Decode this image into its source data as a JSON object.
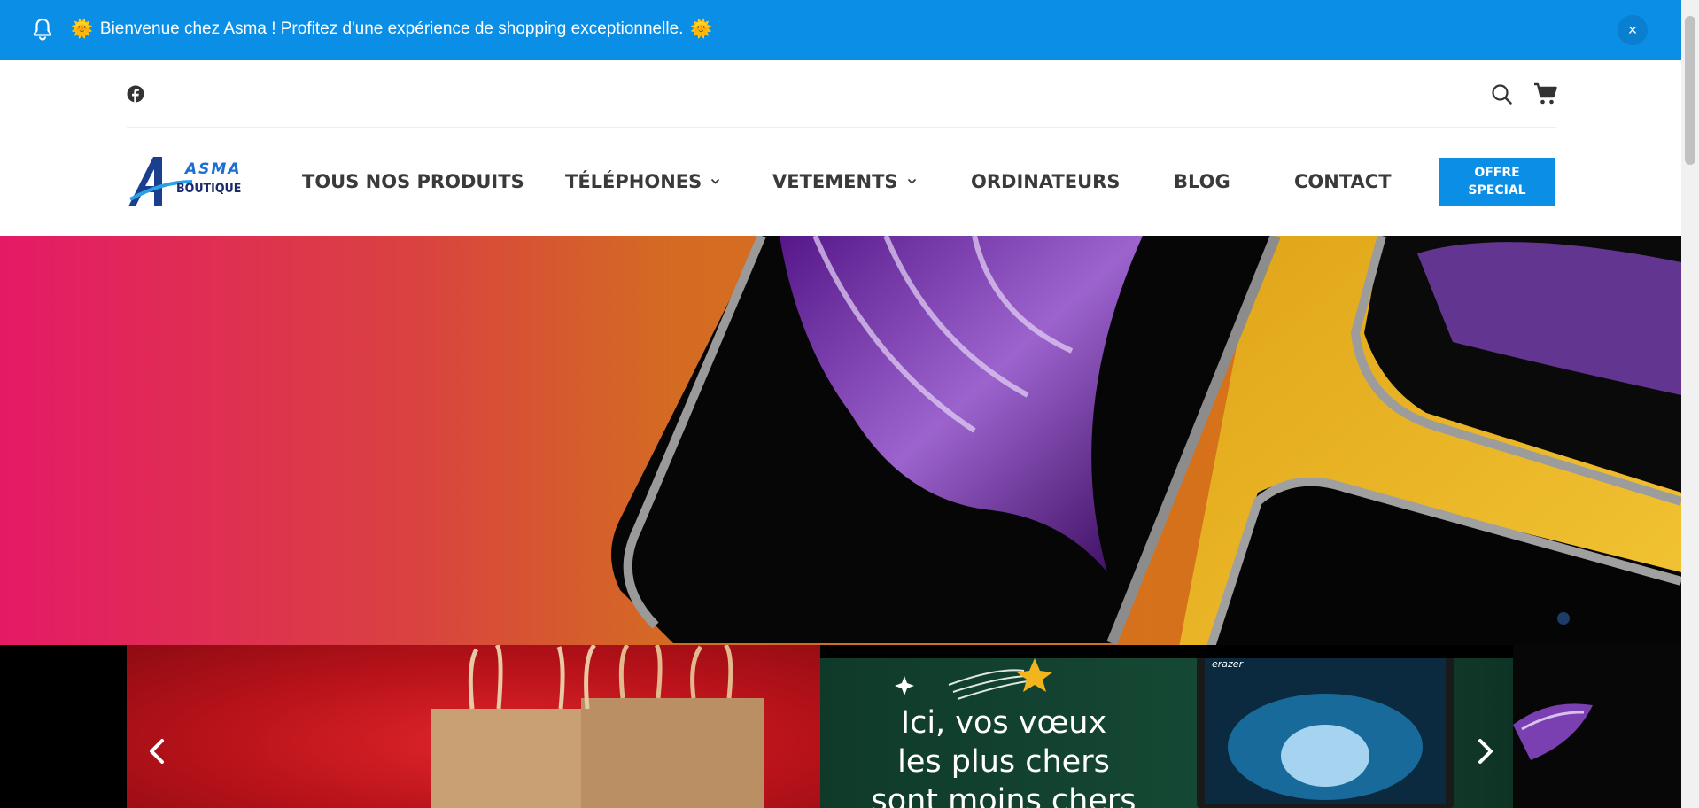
{
  "announcement": {
    "text": "Bienvenue chez Asma ! Profitez d'une expérience de shopping exceptionnelle.",
    "emoji_left": "🌞",
    "emoji_right": "🌞",
    "close_label": "×",
    "icon": "bell-icon",
    "background": "#0a8ee6"
  },
  "utility": {
    "social_icon": "facebook-icon",
    "search_icon": "search-icon",
    "cart_icon": "cart-icon"
  },
  "logo": {
    "mark": "A",
    "line1": "ASMA",
    "line2": "BOUTIQUE"
  },
  "nav": {
    "items": [
      {
        "label": "TOUS NOS PRODUITS",
        "has_dropdown": false
      },
      {
        "label": "TÉLÉPHONES",
        "has_dropdown": true
      },
      {
        "label": "VETEMENTS",
        "has_dropdown": true
      },
      {
        "label": "ORDINATEURS",
        "has_dropdown": false
      },
      {
        "label": "BLOG",
        "has_dropdown": false
      },
      {
        "label": "CONTACT",
        "has_dropdown": false
      }
    ],
    "offer_button": {
      "line1": "OFFRE",
      "line2": "SPECIAL"
    }
  },
  "slider": {
    "green_slide_lines": [
      "Ici, vos vœux",
      "les plus chers",
      "sont moins chers"
    ],
    "laptop_brand": "erazer",
    "prev_icon": "chevron-left-icon",
    "next_icon": "chevron-right-icon"
  },
  "colors": {
    "accent": "#0a8ee6",
    "nav_text": "#3a3a3a"
  }
}
